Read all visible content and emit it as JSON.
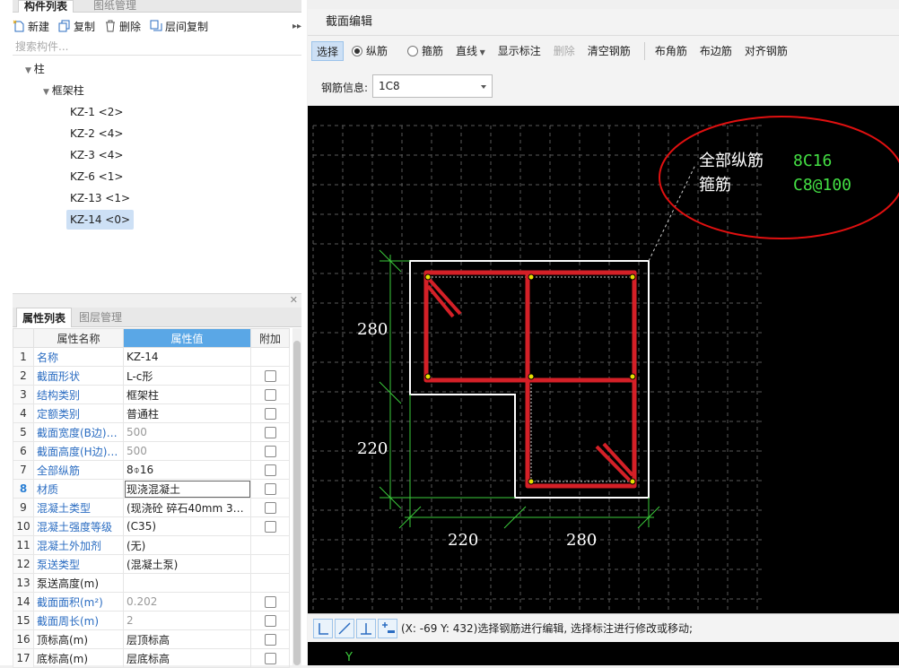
{
  "left_panel": {
    "tabs": [
      "构件列表",
      "图纸管理"
    ],
    "toolbar": {
      "new": "新建",
      "copy": "复制",
      "delete": "删除",
      "floor_copy": "层间复制",
      "more": "▸▸"
    },
    "search_placeholder": "搜索构件...",
    "tree": {
      "root": "柱",
      "group": "框架柱",
      "items": [
        "KZ-1 <2>",
        "KZ-2 <4>",
        "KZ-3 <4>",
        "KZ-6 <1>",
        "KZ-13 <1>",
        "KZ-14 <0>"
      ],
      "selected_index": 5
    },
    "property_tabs": [
      "属性列表",
      "图层管理"
    ],
    "property_headers": [
      "属性名称",
      "属性值",
      "附加"
    ],
    "properties": [
      {
        "n": "1",
        "name": "名称",
        "value": "KZ-14",
        "check": false
      },
      {
        "n": "2",
        "name": "截面形状",
        "value": "L-c形",
        "check": true
      },
      {
        "n": "3",
        "name": "结构类别",
        "value": "框架柱",
        "check": true
      },
      {
        "n": "4",
        "name": "定额类别",
        "value": "普通柱",
        "check": true
      },
      {
        "n": "5",
        "name": "截面宽度(B边)(...",
        "value": "500",
        "check": true
      },
      {
        "n": "6",
        "name": "截面高度(H边)(...",
        "value": "500",
        "check": true
      },
      {
        "n": "7",
        "name": "全部纵筋",
        "value": "8⌽16",
        "check": true
      },
      {
        "n": "8",
        "name": "材质",
        "value": "现浇混凝土",
        "check": true
      },
      {
        "n": "9",
        "name": "混凝土类型",
        "value": "(现浇砼 碎石40mm 32...",
        "check": true
      },
      {
        "n": "10",
        "name": "混凝土强度等级",
        "value": "(C35)",
        "check": true
      },
      {
        "n": "11",
        "name": "混凝土外加剂",
        "value": "(无)",
        "check": false
      },
      {
        "n": "12",
        "name": "泵送类型",
        "value": "(混凝土泵)",
        "check": false
      },
      {
        "n": "13",
        "name": "泵送高度(m)",
        "value": "",
        "check": false
      },
      {
        "n": "14",
        "name": "截面面积(m²)",
        "value": "0.202",
        "check": true
      },
      {
        "n": "15",
        "name": "截面周长(m)",
        "value": "2",
        "check": true
      },
      {
        "n": "16",
        "name": "顶标高(m)",
        "value": "层顶标高",
        "check": true
      },
      {
        "n": "17",
        "name": "底标高(m)",
        "value": "层底标高",
        "check": true
      }
    ]
  },
  "dialog": {
    "title": "截面编辑",
    "toolbar": {
      "select": "选择",
      "longitudinal": "纵筋",
      "stirrup": "箍筋",
      "line": "直线",
      "show_label": "显示标注",
      "delete": "删除",
      "clear": "清空钢筋",
      "corner": "布角筋",
      "edge": "布边筋",
      "align": "对齐钢筋"
    },
    "rebar_info_label": "钢筋信息:",
    "rebar_info_value": "1C8",
    "annotation": {
      "l1": "全部纵筋",
      "v1": "8C16",
      "l2": "箍筋",
      "v2": "C8@100"
    },
    "dims": {
      "left_top": "280",
      "left_bottom": "220",
      "bottom_left": "220",
      "bottom_right": "280"
    },
    "status_text": "(X: -69 Y: 432)选择钢筋进行编辑, 选择标注进行修改或移动;",
    "bottom_axis": "Y"
  },
  "colors": {
    "rebar": "#d42027",
    "dim": "#3ccc3c",
    "value": "#44e044",
    "circle": "#e01010"
  }
}
